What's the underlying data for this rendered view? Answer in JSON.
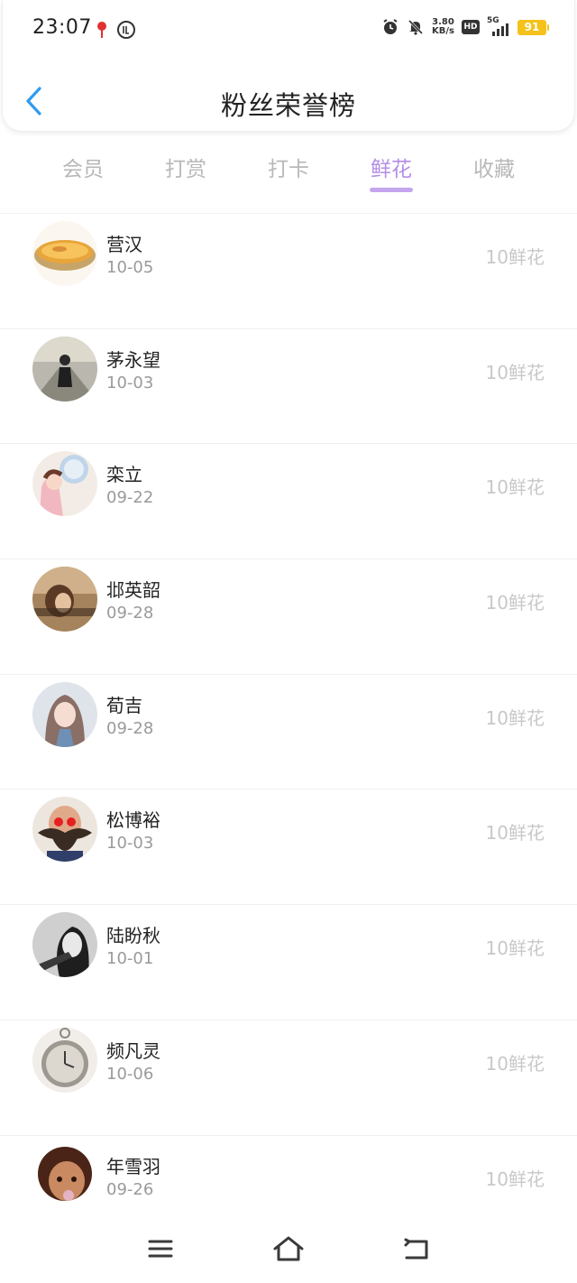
{
  "status_bar": {
    "time": "23:07",
    "net_speed_value": "3.80",
    "net_speed_unit": "KB/s",
    "hd_label": "HD",
    "network_type": "5G",
    "battery_level": "91",
    "battery_color": "#f4c21a"
  },
  "header": {
    "title": "粉丝荣誉榜"
  },
  "tabs": [
    {
      "label": "会员"
    },
    {
      "label": "打赏"
    },
    {
      "label": "打卡"
    },
    {
      "label": "鲜花"
    },
    {
      "label": "收藏"
    }
  ],
  "active_tab": "鲜花",
  "accent_color": "#b48ee6",
  "fans": [
    {
      "name": "营汉",
      "date": "10-05",
      "amount": "10鲜花",
      "avatar": "egg-tart-avatar"
    },
    {
      "name": "茅永望",
      "date": "10-03",
      "amount": "10鲜花",
      "avatar": "person-road-avatar"
    },
    {
      "name": "栾立",
      "date": "09-22",
      "amount": "10鲜花",
      "avatar": "cartoon-girl-avatar"
    },
    {
      "name": "邶英韶",
      "date": "09-28",
      "amount": "10鲜花",
      "avatar": "woman-warm-avatar"
    },
    {
      "name": "荀吉",
      "date": "09-28",
      "amount": "10鲜花",
      "avatar": "anime-girl-avatar"
    },
    {
      "name": "松博裕",
      "date": "10-03",
      "amount": "10鲜花",
      "avatar": "bearded-man-avatar"
    },
    {
      "name": "陆盼秋",
      "date": "10-01",
      "amount": "10鲜花",
      "avatar": "bw-woman-avatar"
    },
    {
      "name": "频凡灵",
      "date": "10-06",
      "amount": "10鲜花",
      "avatar": "pocket-watch-avatar"
    },
    {
      "name": "年雪羽",
      "date": "09-26",
      "amount": "10鲜花",
      "avatar": "cartoon-boy-avatar"
    }
  ]
}
